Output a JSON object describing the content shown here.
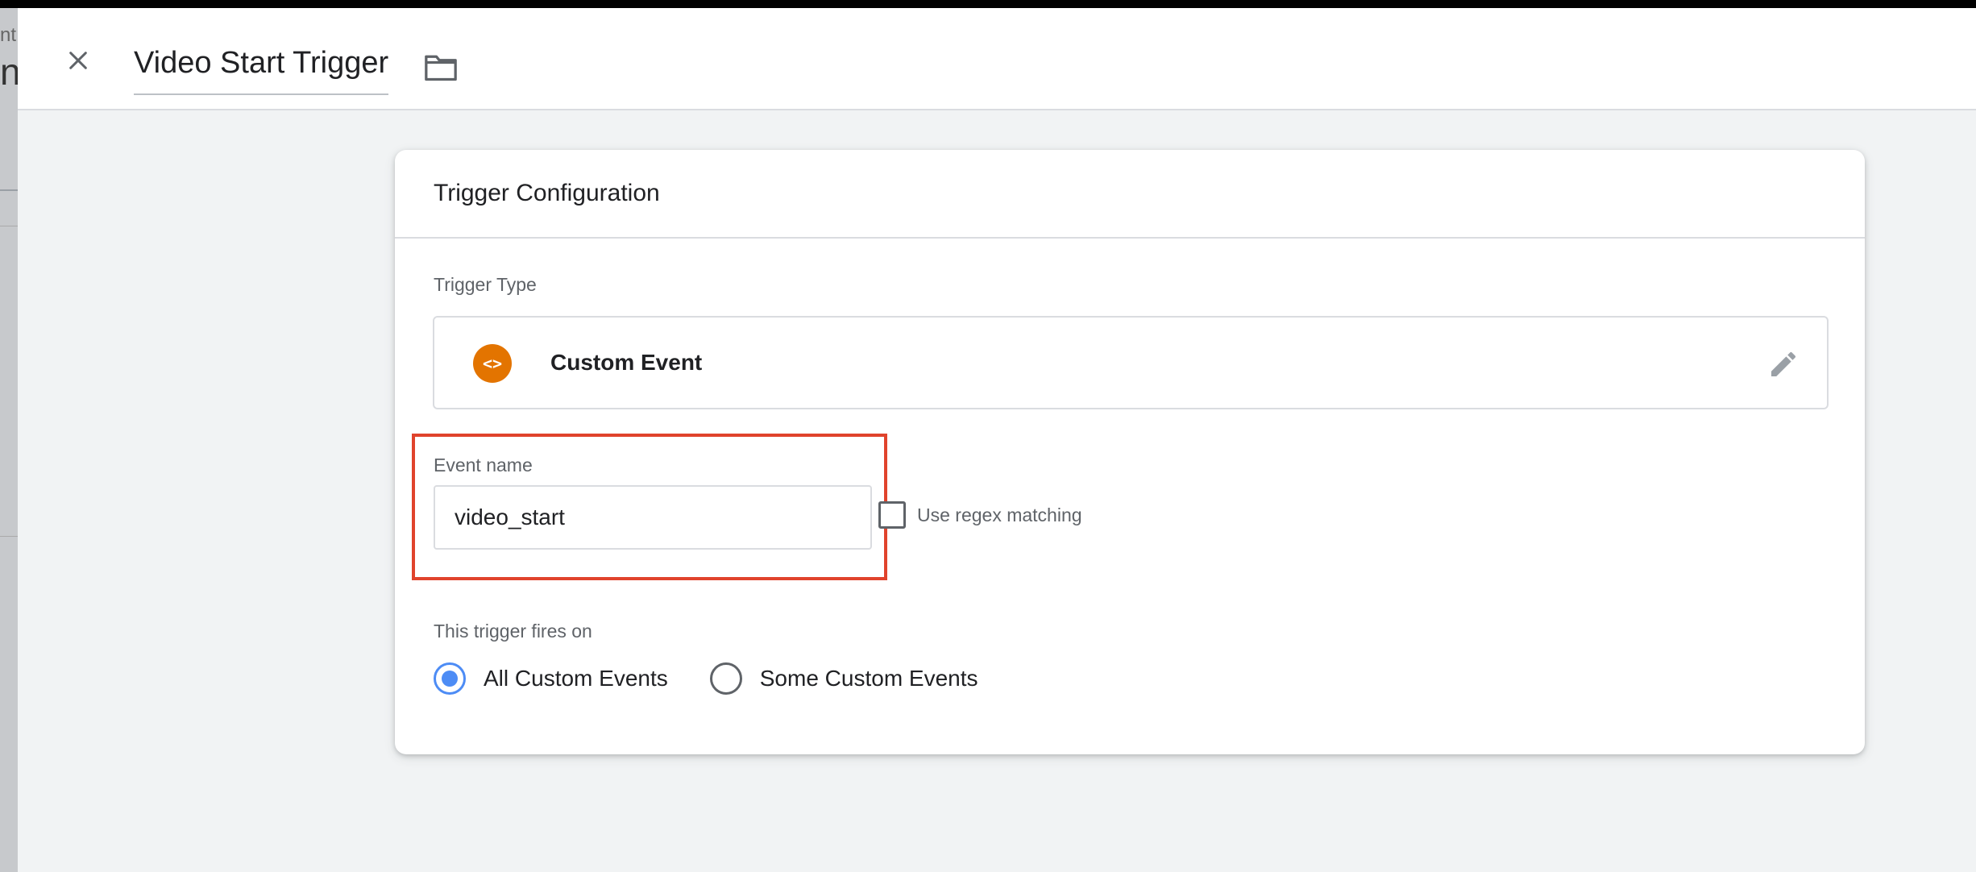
{
  "background_fragments": {
    "top": "nt",
    "bottom": "nt"
  },
  "header": {
    "title": "Video Start Trigger"
  },
  "icons": {
    "close": "close-icon",
    "folder": "folder-icon",
    "type": "custom-event-icon",
    "edit": "pencil-icon"
  },
  "card": {
    "title": "Trigger Configuration",
    "trigger_type_label": "Trigger Type",
    "trigger_type_name": "Custom Event",
    "type_icon_glyph": "<>",
    "event_name_label": "Event name",
    "event_name_value": "video_start",
    "regex_label": "Use regex matching",
    "fires_on_label": "This trigger fires on",
    "fires_on_options": [
      {
        "label": "All Custom Events",
        "selected": true
      },
      {
        "label": "Some Custom Events",
        "selected": false
      }
    ]
  },
  "colors": {
    "accent": "#4d8cf5",
    "highlight": "#e0432c",
    "type_icon": "#e37400"
  }
}
